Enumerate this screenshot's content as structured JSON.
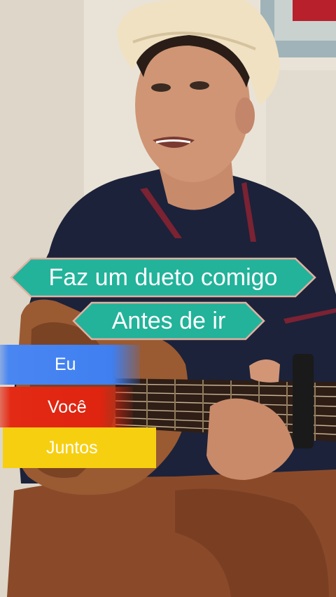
{
  "overlay": {
    "line1": "Faz um dueto comigo",
    "line2": "Antes de ir"
  },
  "parts": {
    "eu": "Eu",
    "voce": "Você",
    "juntos": "Juntos"
  },
  "colors": {
    "banner_fill": "#22b39a",
    "banner_border": "#e2b0a2",
    "eu": "#3f7ff0",
    "voce": "#df2410",
    "juntos": "#f6cf11"
  }
}
